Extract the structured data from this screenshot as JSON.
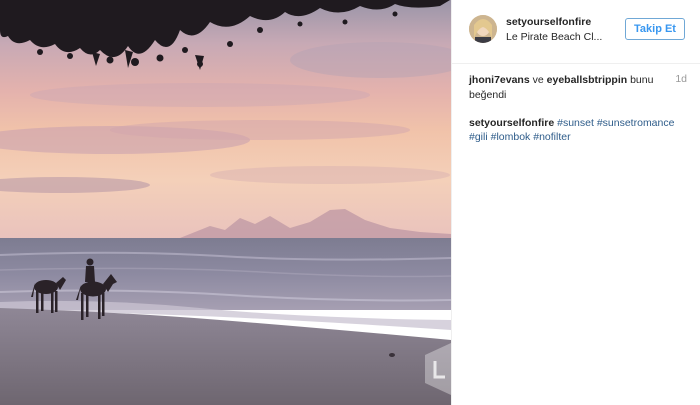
{
  "post": {
    "username": "setyourselfonfire",
    "location": "Le Pirate Beach Cl...",
    "follow_label": "Takip Et",
    "likes": {
      "user1": "jhoni7evans",
      "connector": "ve",
      "user2": "eyeballsbtrippin",
      "suffix": "bunu beğendi"
    },
    "time": "1d",
    "caption": {
      "user": "setyourselfonfire",
      "hashtags": [
        "#sunset",
        "#sunsetromance",
        "#gili",
        "#lombok",
        "#nofilter"
      ]
    }
  },
  "colors": {
    "link": "#3897f0",
    "hashtag": "#2e5c8a",
    "text": "#262626",
    "muted": "#999999"
  },
  "icons": {
    "avatar": "profile-photo",
    "watermark": "app-watermark-icon"
  }
}
